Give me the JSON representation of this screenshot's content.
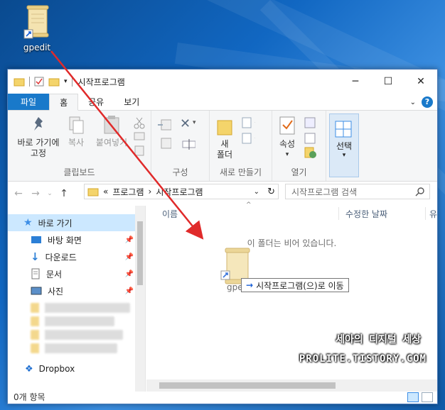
{
  "colors": {
    "accent": "#1979ca",
    "arrow": "#e02a2a",
    "selection": "#cce8ff"
  },
  "desktop": {
    "icon_label": "gpedit",
    "icon": "scroll-shortcut-icon"
  },
  "window": {
    "title": "시작프로그램",
    "controls": {
      "minimize": "─",
      "maximize": "☐",
      "close": "✕"
    }
  },
  "tabs": {
    "file": "파일",
    "home": "홈",
    "share": "공유",
    "view": "보기"
  },
  "ribbon": {
    "clipboard": {
      "pin": "바로 가기에\n고정",
      "copy": "복사",
      "paste": "붙여넣기",
      "group": "클립보드"
    },
    "organize": {
      "group": "구성"
    },
    "new": {
      "folder": "새\n폴더",
      "group": "새로 만들기"
    },
    "open": {
      "properties": "속성",
      "group": "열기"
    },
    "select": {
      "label": "선택"
    }
  },
  "address": {
    "prefix": "«",
    "crumb1": "프로그램",
    "sep": "›",
    "crumb2": "시작프로그램",
    "search_placeholder": "시작프로그램 검색"
  },
  "nav_pane": {
    "quick_access": "바로 가기",
    "items": [
      {
        "label": "바탕 화면"
      },
      {
        "label": "다운로드"
      },
      {
        "label": "문서"
      },
      {
        "label": "사진"
      }
    ],
    "dropbox": "Dropbox"
  },
  "content": {
    "col_name": "이름",
    "col_modified": "수정한 날짜",
    "col_extra": "유",
    "empty_message": "이 폴더는 비어 있습니다."
  },
  "drag": {
    "ghost_label": "gped",
    "tooltip_arrow": "→",
    "tooltip": "시작프로그램(으)로 이동"
  },
  "status": {
    "items": "0개 항목"
  },
  "watermark": {
    "line1": "세아의 디지털 세상",
    "line2": "PROLITE.TISTORY.COM"
  }
}
